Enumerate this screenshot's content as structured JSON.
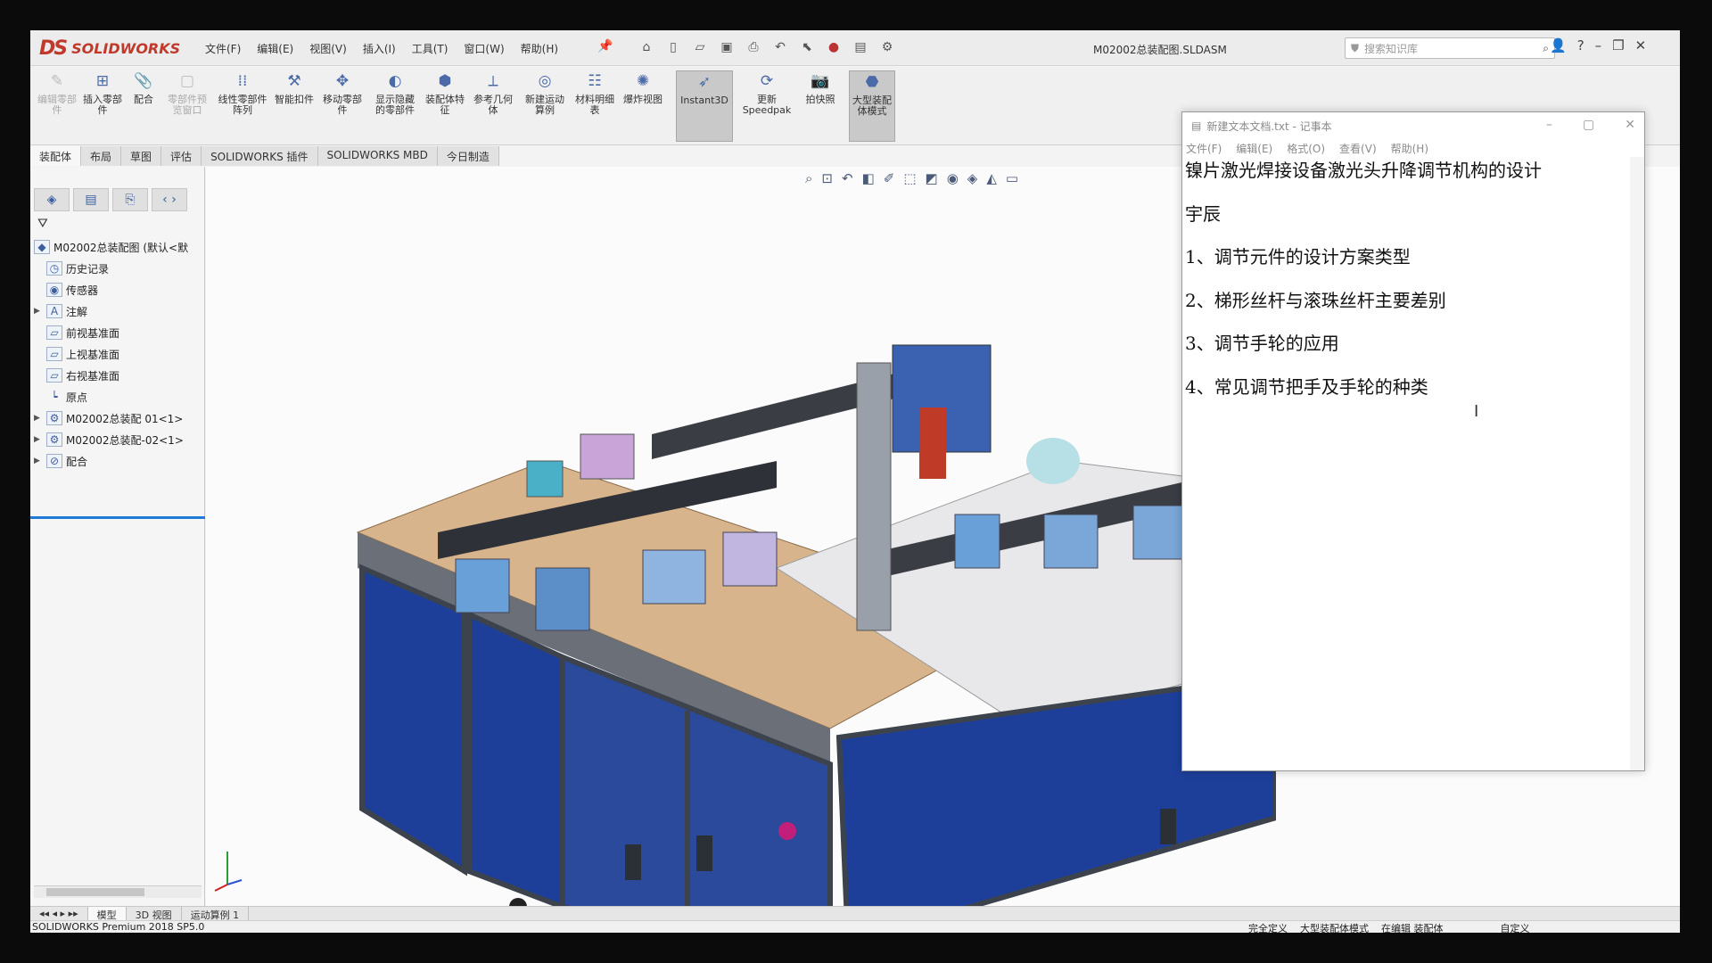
{
  "app": {
    "name": "SOLIDWORKS",
    "document_title": "M02002总装配图.SLDASM"
  },
  "menubar": [
    "文件(F)",
    "编辑(E)",
    "视图(V)",
    "插入(I)",
    "工具(T)",
    "窗口(W)",
    "帮助(H)"
  ],
  "search": {
    "placeholder": "搜索知识库"
  },
  "ribbon": [
    {
      "label": "编辑零部件",
      "enabled": false
    },
    {
      "label": "插入零部件",
      "enabled": true
    },
    {
      "label": "配合",
      "enabled": true
    },
    {
      "label": "零部件预览窗口",
      "enabled": false
    },
    {
      "label": "线性零部件阵列",
      "enabled": true
    },
    {
      "label": "智能扣件",
      "enabled": true
    },
    {
      "label": "移动零部件",
      "enabled": true
    },
    {
      "label": "显示隐藏的零部件",
      "enabled": true
    },
    {
      "label": "装配体特征",
      "enabled": true
    },
    {
      "label": "参考几何体",
      "enabled": true
    },
    {
      "label": "新建运动算例",
      "enabled": true
    },
    {
      "label": "材料明细表",
      "enabled": true
    },
    {
      "label": "爆炸视图",
      "enabled": true
    },
    {
      "label": "Instant3D",
      "enabled": true,
      "active": true
    },
    {
      "label": "更新 Speedpak",
      "enabled": true
    },
    {
      "label": "拍快照",
      "enabled": true
    },
    {
      "label": "大型装配体模式",
      "enabled": true,
      "active": true
    }
  ],
  "command_tabs": [
    "装配体",
    "布局",
    "草图",
    "评估",
    "SOLIDWORKS 插件",
    "SOLIDWORKS MBD",
    "今日制造"
  ],
  "feature_tree": {
    "filter_icon": "filter-icon",
    "items": [
      {
        "label": "M02002总装配图 (默认<默",
        "icon": "assembly-icon",
        "expandable": false
      },
      {
        "label": "历史记录",
        "icon": "history-icon",
        "expandable": false
      },
      {
        "label": "传感器",
        "icon": "sensor-icon",
        "expandable": false
      },
      {
        "label": "注解",
        "icon": "annotation-icon",
        "expandable": true
      },
      {
        "label": "前视基准面",
        "icon": "plane-icon",
        "expandable": false
      },
      {
        "label": "上视基准面",
        "icon": "plane-icon",
        "expandable": false
      },
      {
        "label": "右视基准面",
        "icon": "plane-icon",
        "expandable": false
      },
      {
        "label": "原点",
        "icon": "origin-icon",
        "expandable": false
      },
      {
        "label": "M02002总装配 01<1>",
        "icon": "subassembly-icon",
        "expandable": true
      },
      {
        "label": "M02002总装配-02<1>",
        "icon": "subassembly-icon",
        "expandable": true
      },
      {
        "label": "配合",
        "icon": "mates-icon",
        "expandable": true
      }
    ]
  },
  "bottom_tabs": [
    "模型",
    "3D 视图",
    "运动算例 1"
  ],
  "status": {
    "version": "SOLIDWORKS Premium 2018 SP5.0",
    "state": [
      "完全定义",
      "大型装配体模式",
      "在编辑 装配体"
    ],
    "units": "自定义"
  },
  "notepad": {
    "title": "新建文本文档.txt - 记事本",
    "menu": [
      "文件(F)",
      "编辑(E)",
      "格式(O)",
      "查看(V)",
      "帮助(H)"
    ],
    "lines": [
      "镍片激光焊接设备激光头升降调节机构的设计",
      "宇辰",
      "1、调节元件的设计方案类型",
      "2、梯形丝杆与滚珠丝杆主要差别",
      "3、调节手轮的应用",
      "4、常见调节把手及手轮的种类"
    ]
  },
  "colors": {
    "accent": "#1f7ad8",
    "brand": "#c0392b",
    "cabinet_blue": "#1d3f9a",
    "frame_gray": "#4a4f57",
    "table_top": "#d8b48c"
  }
}
